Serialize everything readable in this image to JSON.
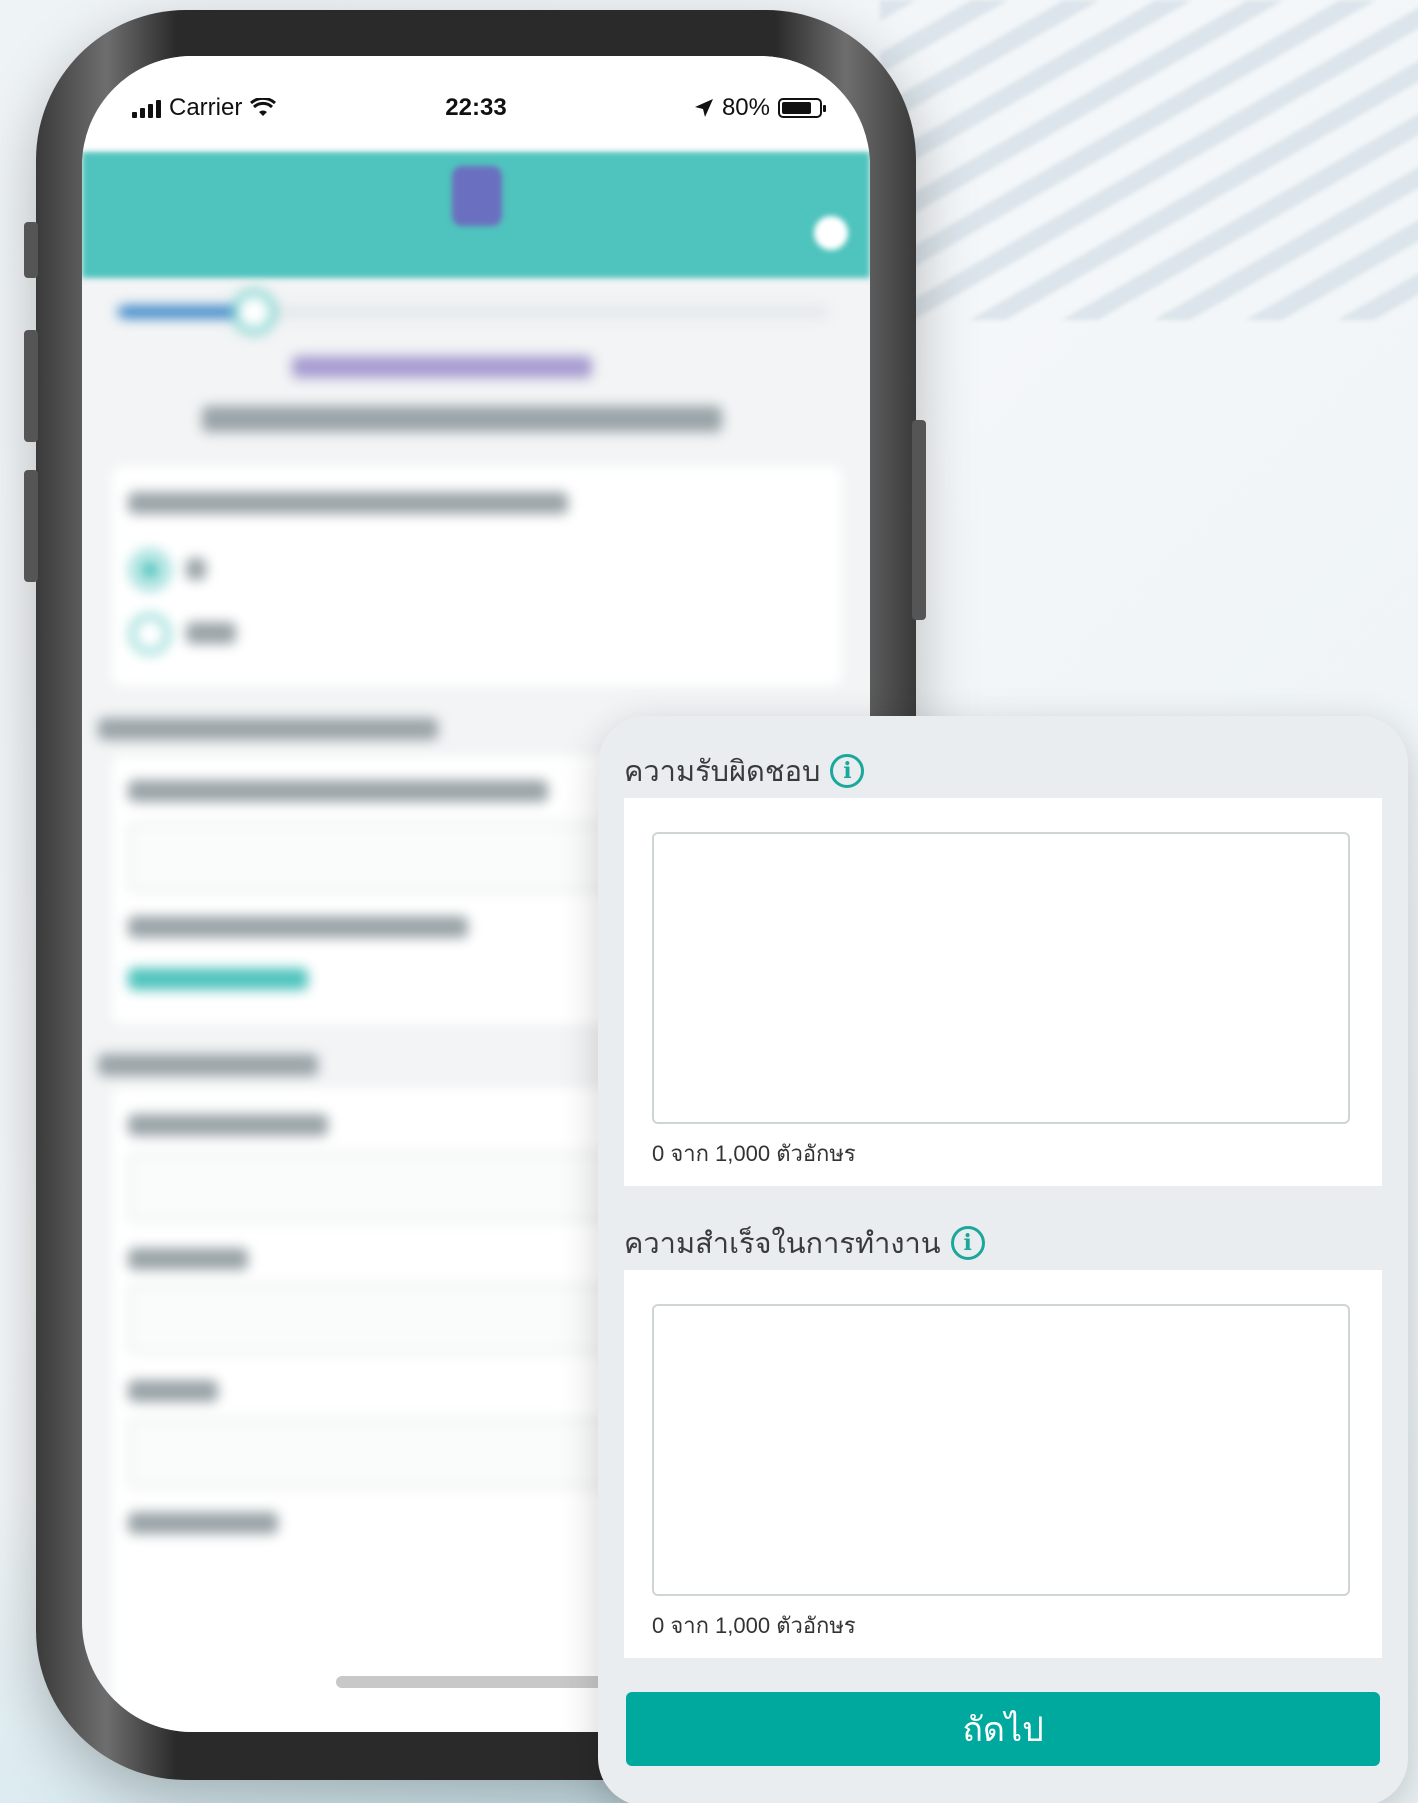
{
  "status_bar": {
    "carrier": "Carrier",
    "time": "22:33",
    "battery_percent": "80%",
    "battery_level": 0.8
  },
  "panel": {
    "responsibility": {
      "label": "ความรับผิดชอบ",
      "value": "",
      "counter": "0 จาก 1,000 ตัวอักษร"
    },
    "achievements": {
      "label": "ความสำเร็จในการทำงาน",
      "value": "",
      "counter": "0 จาก 1,000 ตัวอักษร"
    },
    "next_button": "ถัดไป"
  },
  "colors": {
    "accent": "#00a99d",
    "header": "#4fc3bd",
    "info_icon": "#1ba89b",
    "panel_bg": "#e9edf0"
  },
  "icons": [
    "signal-icon",
    "wifi-icon",
    "location-arrow-icon",
    "battery-icon",
    "info-icon"
  ]
}
